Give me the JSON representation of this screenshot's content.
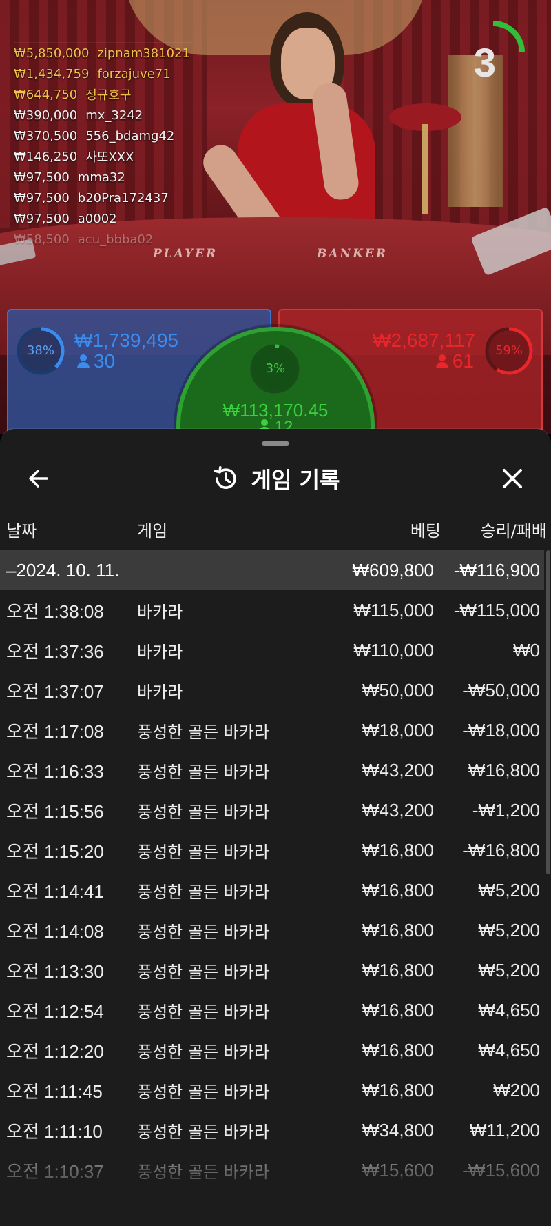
{
  "video": {
    "table_labels": {
      "player": "PLAYER",
      "banker": "BANKER"
    },
    "timer": {
      "value": "3",
      "color": "#2fbf3a"
    },
    "bettors": [
      {
        "amount": "₩5,850,000",
        "name": "zipnam381021",
        "tone": "gold"
      },
      {
        "amount": "₩1,434,759",
        "name": "forzajuve71",
        "tone": "gold"
      },
      {
        "amount": "₩644,750",
        "name": "정규호구",
        "tone": "gold"
      },
      {
        "amount": "₩390,000",
        "name": "mx_3242",
        "tone": "white"
      },
      {
        "amount": "₩370,500",
        "name": "556_bdamg42",
        "tone": "white"
      },
      {
        "amount": "₩146,250",
        "name": "사또XXX",
        "tone": "white"
      },
      {
        "amount": "₩97,500",
        "name": "mma32",
        "tone": "white"
      },
      {
        "amount": "₩97,500",
        "name": "b20Pra172437",
        "tone": "white"
      },
      {
        "amount": "₩97,500",
        "name": "a0002",
        "tone": "white"
      },
      {
        "amount": "₩58,500",
        "name": "acu_bbba02",
        "tone": "faded"
      }
    ],
    "player_bet": {
      "percent": "38%",
      "percent_value": 38,
      "amount": "₩1,739,495",
      "count": "30",
      "color": "#3b8cf0"
    },
    "banker_bet": {
      "percent": "59%",
      "percent_value": 59,
      "amount": "₩2,687,117",
      "count": "61",
      "color": "#e8262c"
    },
    "tie_bet": {
      "percent": "3%",
      "percent_value": 3,
      "amount": "₩113,170.45",
      "count": "12",
      "color": "#2fbf3a"
    }
  },
  "sheet": {
    "title": "게임 기록",
    "icons": {
      "back": "arrow-left-icon",
      "history": "history-icon",
      "close": "close-icon"
    },
    "columns": {
      "date": "날짜",
      "game": "게임",
      "bet": "베팅",
      "win_loss": "승리/패배"
    },
    "date_group": {
      "label": "–2024. 10. 11.",
      "bet": "₩609,800",
      "win_loss": "-₩116,900"
    },
    "rows": [
      {
        "time": "오전 1:38:08",
        "game": "바카라",
        "bet": "₩115,000",
        "win_loss": "-₩115,000"
      },
      {
        "time": "오전 1:37:36",
        "game": "바카라",
        "bet": "₩110,000",
        "win_loss": "₩0"
      },
      {
        "time": "오전 1:37:07",
        "game": "바카라",
        "bet": "₩50,000",
        "win_loss": "-₩50,000"
      },
      {
        "time": "오전 1:17:08",
        "game": "풍성한 골든 바카라",
        "bet": "₩18,000",
        "win_loss": "-₩18,000"
      },
      {
        "time": "오전 1:16:33",
        "game": "풍성한 골든 바카라",
        "bet": "₩43,200",
        "win_loss": "₩16,800"
      },
      {
        "time": "오전 1:15:56",
        "game": "풍성한 골든 바카라",
        "bet": "₩43,200",
        "win_loss": "-₩1,200"
      },
      {
        "time": "오전 1:15:20",
        "game": "풍성한 골든 바카라",
        "bet": "₩16,800",
        "win_loss": "-₩16,800"
      },
      {
        "time": "오전 1:14:41",
        "game": "풍성한 골든 바카라",
        "bet": "₩16,800",
        "win_loss": "₩5,200"
      },
      {
        "time": "오전 1:14:08",
        "game": "풍성한 골든 바카라",
        "bet": "₩16,800",
        "win_loss": "₩5,200"
      },
      {
        "time": "오전 1:13:30",
        "game": "풍성한 골든 바카라",
        "bet": "₩16,800",
        "win_loss": "₩5,200"
      },
      {
        "time": "오전 1:12:54",
        "game": "풍성한 골든 바카라",
        "bet": "₩16,800",
        "win_loss": "₩4,650"
      },
      {
        "time": "오전 1:12:20",
        "game": "풍성한 골든 바카라",
        "bet": "₩16,800",
        "win_loss": "₩4,650"
      },
      {
        "time": "오전 1:11:45",
        "game": "풍성한 골든 바카라",
        "bet": "₩16,800",
        "win_loss": "₩200"
      },
      {
        "time": "오전 1:11:10",
        "game": "풍성한 골든 바카라",
        "bet": "₩34,800",
        "win_loss": "₩11,200"
      },
      {
        "time": "오전 1:10:37",
        "game": "풍성한 골든 바카라",
        "bet": "₩15,600",
        "win_loss": "-₩15,600"
      }
    ]
  }
}
